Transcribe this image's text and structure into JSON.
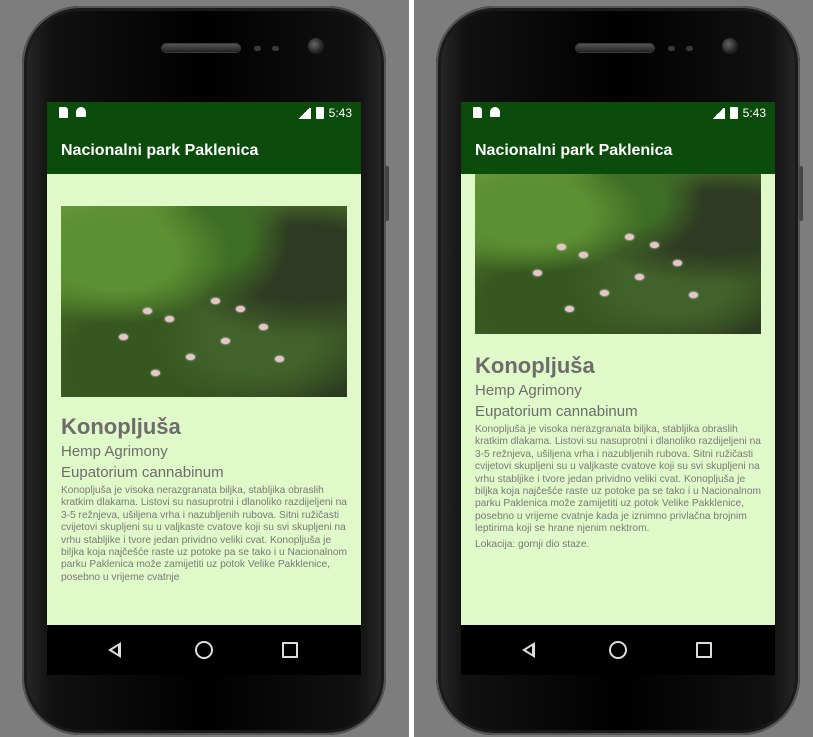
{
  "left": {
    "status": {
      "time": "5:43"
    },
    "appbar": {
      "title": "Nacionalni park Paklenica"
    },
    "plant": {
      "name_hr": "Konopljuša",
      "name_en": "Hemp Agrimony",
      "name_lat": "Eupatorium cannabinum",
      "description": "Konopljuša je visoka nerazgranata biljka, stabljika obraslih kratkim dlakama. Listovi su nasuprotni i dlanoliko razdijeljeni na 3-5 režnjeva, ušiljena vrha i nazubljenih rubova. Sitni ružičasti cvijetovi skupljeni su u valjkaste cvatove koji su svi skupljeni na vrhu stabljike i tvore jedan prividno veliki cvat. Konopljuša je biljka koja najčešće raste uz potoke pa se tako i u Nacionalnom parku Paklenica može zamijetiti uz potok Velike Pakklenice, posebno u vrijeme cvatnje"
    }
  },
  "right": {
    "status": {
      "time": "5:43"
    },
    "appbar": {
      "title": "Nacionalni park Paklenica"
    },
    "plant": {
      "name_hr": "Konopljuša",
      "name_en": "Hemp Agrimony",
      "name_lat": "Eupatorium cannabinum",
      "description": "Konopljuša je visoka nerazgranata biljka, stabljika obraslih kratkim dlakama. Listovi su nasuprotni i dlanoliko razdijeljeni na 3-5 režnjeva, ušiljena vrha i nazubljenih rubova. Sitni ružičasti cvijetovi skupljeni su u valjkaste cvatove koji su svi skupljeni na vrhu stabljike i tvore jedan prividno veliki cvat. Konopljuša je biljka koja najčešće raste uz potoke pa se tako i u Nacionalnom parku Paklenica može zamijetiti uz potok Velike Pakklenice, posebno u vrijeme cvatnje kada je iznimno privlačna brojnim leptirima koji se hrane njenim nektrom.",
      "location": "Lokacija: gornji dio staze."
    }
  },
  "colors": {
    "appbar": "#0b4b0b",
    "content_bg": "#e0f9c9",
    "text_gray": "#6d6d6d"
  },
  "icons": [
    "sd-card-icon",
    "android-icon",
    "signal-icon",
    "battery-icon",
    "back-icon",
    "home-icon",
    "recents-icon"
  ]
}
